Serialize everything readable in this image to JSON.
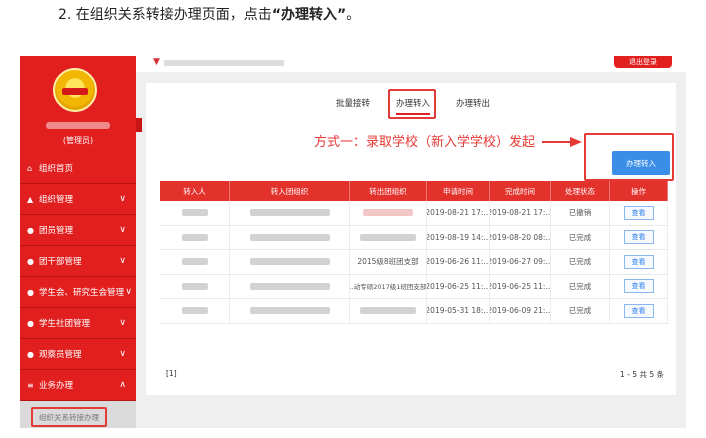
{
  "instruction": {
    "prefix": "2. 在组织关系转接办理页面，点击",
    "highlight": "“办理转入”",
    "suffix": "。"
  },
  "header": {
    "exit_label": "退出登录"
  },
  "sidebar": {
    "role": "(管理员)",
    "items": [
      {
        "label": "组织首页",
        "icon": "home-icon",
        "has_chevron": false
      },
      {
        "label": "组织管理",
        "icon": "org-icon",
        "has_chevron": true
      },
      {
        "label": "团员管理",
        "icon": "member-icon",
        "has_chevron": true
      },
      {
        "label": "团干部管理",
        "icon": "cadre-icon",
        "has_chevron": true
      },
      {
        "label": "学生会、研究生会管理",
        "icon": "union-icon",
        "has_chevron": true
      },
      {
        "label": "学生社团管理",
        "icon": "club-icon",
        "has_chevron": true
      },
      {
        "label": "观察员管理",
        "icon": "observer-icon",
        "has_chevron": true
      },
      {
        "label": "业务办理",
        "icon": "menu-icon",
        "has_chevron": true,
        "expanded": true
      }
    ],
    "submenu_item": "组织关系转接办理"
  },
  "tabs": [
    "批量接转",
    "办理转入",
    "办理转出"
  ],
  "active_tab": 1,
  "annotation": "方式一：录取学校（新入学学校）发起",
  "transfer_button": "办理转入",
  "table": {
    "columns": [
      "转入人",
      "转入团组织",
      "转出团组织",
      "申请时间",
      "完成时间",
      "处理状态",
      "操作"
    ],
    "rows": [
      {
        "from_org": "",
        "apply_time": "2019-08-21 17:...",
        "done_time": "2019-08-21 17:...",
        "status": "已撤销",
        "action": "查看"
      },
      {
        "from_org": "",
        "apply_time": "2019-08-19 14:...",
        "done_time": "2019-08-20 08:...",
        "status": "已完成",
        "action": "查看"
      },
      {
        "from_org": "2015级8班团支部",
        "apply_time": "2019-06-26 11:...",
        "done_time": "2019-06-27 09:...",
        "status": "已完成",
        "action": "查看"
      },
      {
        "from_org": "..动专硕2017级1班团支部",
        "apply_time": "2019-06-25 11:...",
        "done_time": "2019-06-25 11:...",
        "status": "已完成",
        "action": "查看"
      },
      {
        "from_org": "",
        "apply_time": "2019-05-31 18:...",
        "done_time": "2019-06-09 21:...",
        "status": "已完成",
        "action": "查看"
      }
    ]
  },
  "pagination": {
    "current": "[1]",
    "summary": "1 - 5  共 5 条"
  },
  "colors": {
    "brand_red": "#e21f1f",
    "button_blue": "#3b8ee8",
    "annotation_red": "#e53935"
  }
}
